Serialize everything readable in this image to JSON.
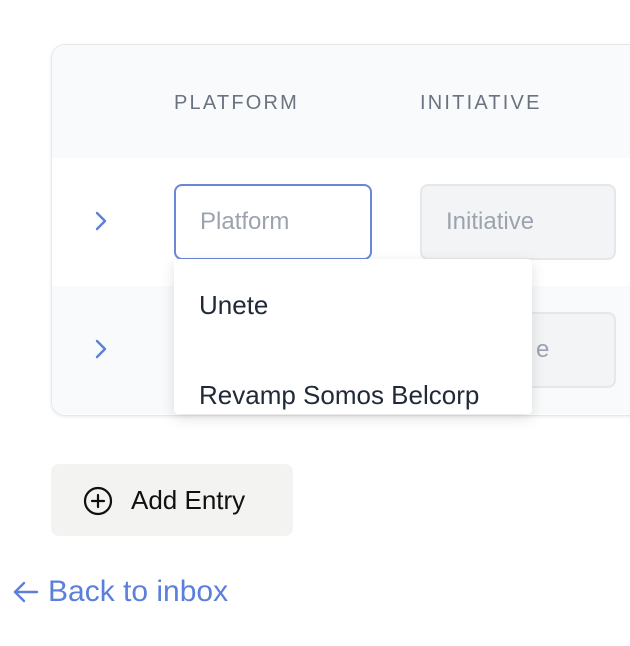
{
  "table": {
    "columns": {
      "platform": "PLATFORM",
      "initiative": "INITIATIVE"
    },
    "rows": [
      {
        "platform_placeholder": "Platform",
        "initiative_placeholder": "Initiative"
      },
      {
        "initiative_visible_fragment": "e"
      }
    ]
  },
  "dropdown": {
    "options": [
      "Unete",
      "Revamp Somos Belcorp"
    ]
  },
  "actions": {
    "add_entry_label": "Add Entry",
    "back_label": "Back to inbox"
  },
  "icons": {
    "expand": "chevron-right-icon",
    "add": "plus-circle-icon",
    "back": "arrow-left-icon"
  },
  "colors": {
    "accent": "#5b7fdb",
    "focus_border": "#6a87d8",
    "header_bg": "#f9fafb",
    "button_bg": "#f3f3f1"
  }
}
